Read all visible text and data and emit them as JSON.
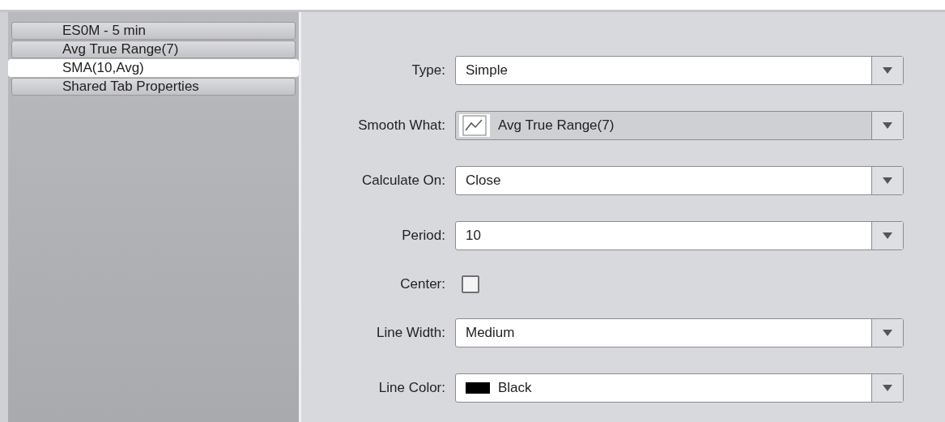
{
  "tabs": [
    {
      "label": "ES0M - 5 min",
      "selected": false
    },
    {
      "label": "Avg True Range(7)",
      "selected": false
    },
    {
      "label": "SMA(10,Avg)",
      "selected": true
    },
    {
      "label": "Shared Tab Properties",
      "selected": false
    }
  ],
  "fields": [
    {
      "label": "Type:",
      "kind": "select",
      "value": "Simple",
      "disabled": false
    },
    {
      "label": "Smooth What:",
      "kind": "series-select",
      "value": "Avg True Range(7)",
      "disabled": true
    },
    {
      "label": "Calculate On:",
      "kind": "select",
      "value": "Close",
      "disabled": false
    },
    {
      "label": "Period:",
      "kind": "select",
      "value": "10",
      "disabled": false
    },
    {
      "label": "Center:",
      "kind": "checkbox",
      "checked": false
    },
    {
      "label": "Line Width:",
      "kind": "select",
      "value": "Medium",
      "disabled": false
    },
    {
      "label": "Line Color:",
      "kind": "color-select",
      "value": "Black",
      "color": "#000000",
      "disabled": false
    }
  ]
}
